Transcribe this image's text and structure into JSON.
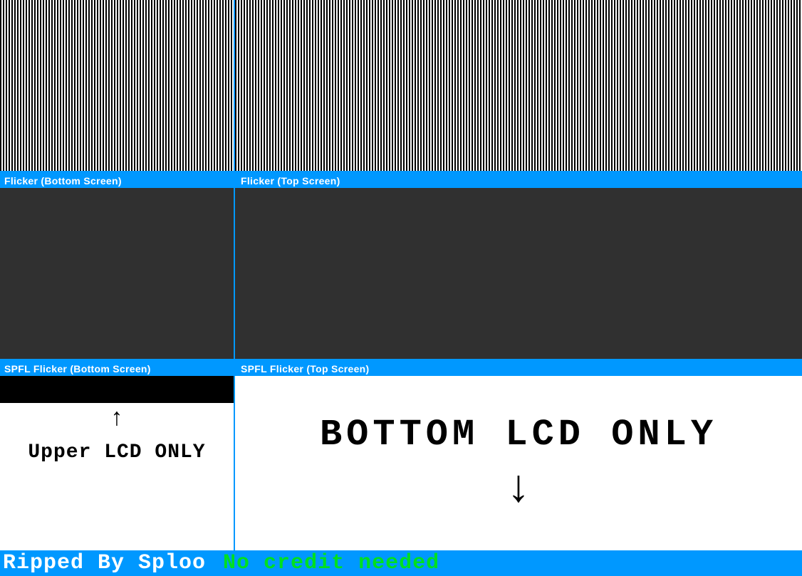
{
  "labels": {
    "flicker_bottom": "Flicker (Bottom Screen)",
    "flicker_top": "Flicker (Top Screen)",
    "spfl_bottom": "SPFL Flicker (Bottom Screen)",
    "spfl_top": "SPFL Flicker (Top Screen)"
  },
  "lcd": {
    "upper_arrow": "↑",
    "upper_text": "Upper LCD ONLY",
    "bottom_text": "BOTTOM LCD ONLY",
    "bottom_arrow": "↓"
  },
  "footer": {
    "ripped": "Ripped By Sploo",
    "credit": "No credit needed"
  },
  "colors": {
    "accent": "#0098ff",
    "panel_dark": "#303030",
    "credit_green": "#00e020"
  }
}
